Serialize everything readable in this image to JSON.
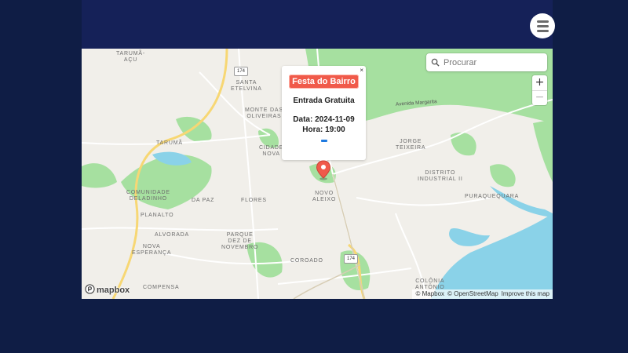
{
  "map": {
    "search_placeholder": "Procurar",
    "zoom_in": "+",
    "zoom_out": "−",
    "logo_text": "mapbox",
    "attribution": [
      "© Mapbox",
      "© OpenStreetMap",
      "Improve this map"
    ],
    "road_label": "Avenida Margarita",
    "highway_shields": [
      "174",
      "174"
    ],
    "place_labels": {
      "taruma_acu": "TARUMÃ-\nAÇU",
      "santa_etelvina": "SANTA\nETELVINA",
      "monte_das_oliveiras": "MONTE DAS\nOLIVEIRAS",
      "taruma": "TARUMÃ",
      "cidade_nova": "CIDADE\nNOVA",
      "jorge_teixeira": "JORGE\nTEIXEIRA",
      "distrito_industrial": "DISTRITO\nINDUSTRIAL II",
      "puraquequara": "PURAQUEQUARA",
      "comunidade_deladinho": "COMUNIDADE\nDELADINHO",
      "da_paz": "DA PAZ",
      "flores": "FLORES",
      "novo_aleixo": "NOVO\nALEIXO",
      "planalto": "PLANALTO",
      "alvorada": "ALVORADA",
      "parque_dez": "PARQUE\nDEZ DE\nNOVEMBRO",
      "nova_esperanca": "NOVA\nESPERANÇA",
      "coroado": "COROADO",
      "compensa": "COMPENSA",
      "colonia_antonio": "COLÔNIA\nANTÔNIO"
    }
  },
  "popup": {
    "close": "×",
    "title": "Festa do Bairro",
    "entry": "Entrada Gratuita",
    "date": "Data: 2024-11-09",
    "time": "Hora: 19:00"
  },
  "colors": {
    "page_bg": "#0f1d45",
    "header_bg": "#152158",
    "water": "#8ad2e8",
    "park": "#a6e0a0",
    "highway": "#f7d774",
    "marker": "#f05a4a"
  }
}
